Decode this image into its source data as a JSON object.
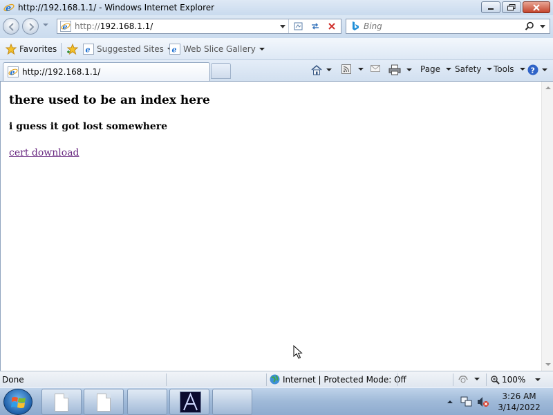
{
  "window": {
    "title": "http://192.168.1.1/ - Windows Internet Explorer",
    "icon": "ie-icon",
    "buttons": [
      "minimize-icon",
      "restore-icon",
      "close-icon"
    ]
  },
  "nav": {
    "back_icon": "back-arrow-icon",
    "forward_icon": "forward-arrow-icon",
    "address": {
      "scheme": "http://",
      "host": "192.168.1.1/"
    },
    "address_icons": [
      "compatibility-view-icon",
      "refresh-icon",
      "stop-icon"
    ],
    "search": {
      "placeholder": "Bing",
      "icon": "search-icon"
    }
  },
  "favorites_bar": {
    "favorites_label": "Favorites",
    "suggested_sites_label": "Suggested Sites",
    "web_slice_label": "Web Slice Gallery"
  },
  "tab": {
    "title": "http://192.168.1.1/"
  },
  "command_bar": {
    "page_label": "Page",
    "safety_label": "Safety",
    "tools_label": "Tools",
    "icons": [
      "home-icon",
      "feeds-icon",
      "read-mail-icon",
      "print-icon",
      "help-icon"
    ]
  },
  "page": {
    "heading": "there used to be an index here",
    "subheading": "i guess it got lost somewhere",
    "link_text": "cert download",
    "link_color": "#6a2b82"
  },
  "status": {
    "text": "Done",
    "zone": "Internet | Protected Mode: Off",
    "zoom": "100%"
  },
  "taskbar": {
    "time": "3:26 AM",
    "date": "3/14/2022"
  },
  "colors": {
    "chrome": "#cfe0f3",
    "close_button": "#c4452d",
    "taskbar": "#9fb9d8"
  }
}
